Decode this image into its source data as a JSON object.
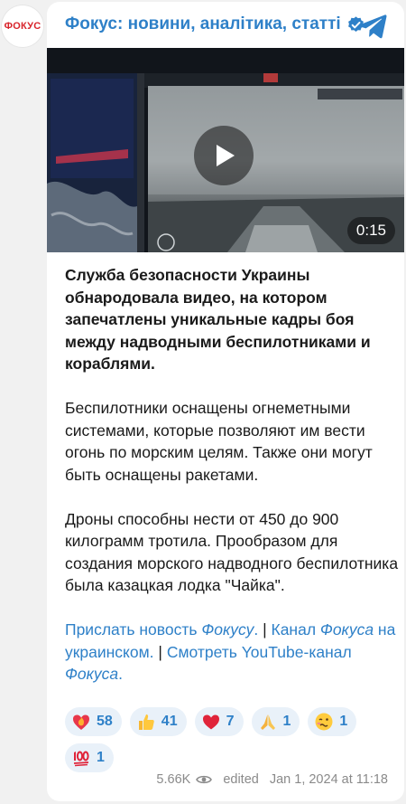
{
  "channel": {
    "avatar_text": "ФОКУС",
    "name": "Фокус: новини, аналітика, статті"
  },
  "video": {
    "duration": "0:15"
  },
  "post": {
    "paragraph1": "Служба безопасности Украины обнародовала видео, на котором запечатлены уникальные кадры боя между надводными беспилотниками и кораблями.",
    "paragraph2": "Беспилотники оснащены огнеметными системами, которые позволяют им вести огонь по морским целям. Также они могут быть оснащены ракетами.",
    "paragraph3": "Дроны способны нести от 450 до 900 килограмм тротила. Прообразом для создания морского надводного беспилотника была казацкая лодка \"Чайка\".",
    "links": {
      "send_news": "Прислать новость ",
      "send_news_brand": "Фокусу",
      "period1": ".",
      "separator1": " | ",
      "channel_prefix": "Канал ",
      "channel_brand": "Фокуса",
      "channel_suffix": " на украинском.",
      "separator2": " | ",
      "youtube_prefix": "Смотреть YouTube-канал ",
      "youtube_brand": "Фокуса",
      "period2": "."
    }
  },
  "reactions": [
    {
      "icon": "heart-on-fire-icon",
      "count": "58"
    },
    {
      "icon": "thumbs-up-icon",
      "count": "41"
    },
    {
      "icon": "red-heart-icon",
      "count": "7"
    },
    {
      "icon": "folded-hands-icon",
      "count": "1"
    },
    {
      "icon": "woozy-face-icon",
      "count": "1"
    },
    {
      "icon": "hundred-points-icon",
      "count": "1"
    }
  ],
  "footer": {
    "views": "5.66K",
    "edited": "edited",
    "date": "Jan 1, 2024 at 11:18"
  },
  "colors": {
    "accent": "#2e80c8",
    "background": "#f1f1f1",
    "card": "#ffffff",
    "reaction_bg": "#e9f1f9",
    "brand_red": "#d8232a"
  }
}
